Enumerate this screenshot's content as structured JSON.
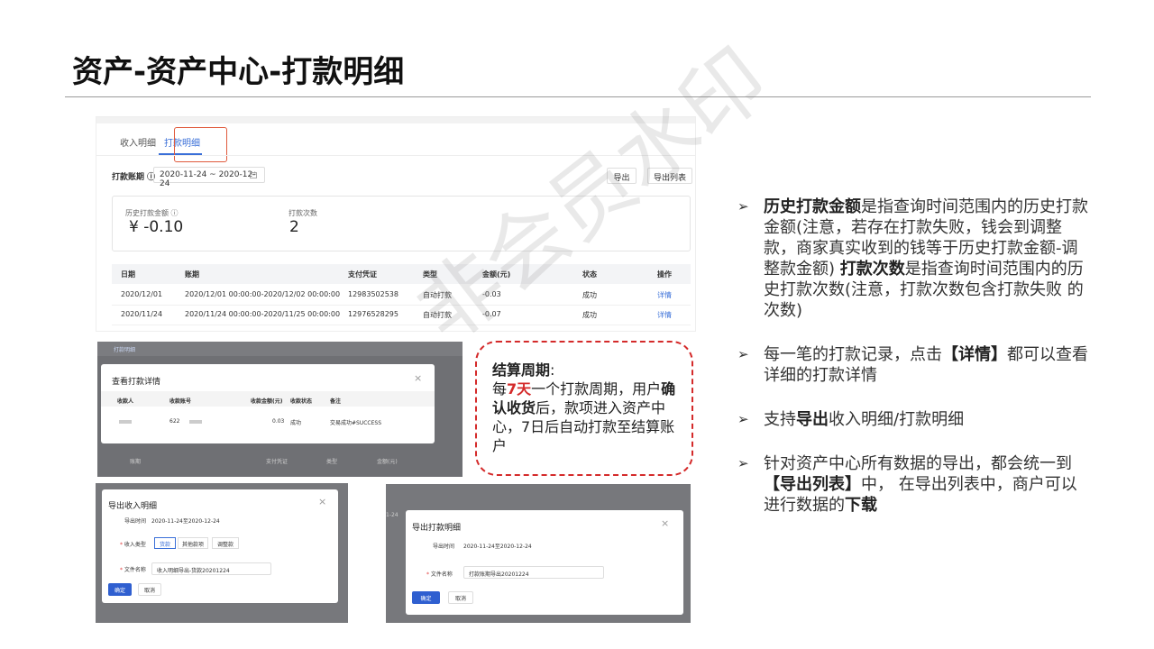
{
  "title": "资产-资产中心-打款明细",
  "watermark": "非会员水印",
  "screenshot_main": {
    "tabs": [
      {
        "label": "收入明细"
      },
      {
        "label": "打款明细"
      }
    ],
    "period_label": "打款账期 ⓘ",
    "period_value": "2020-11-24 ~ 2020-12-24",
    "calendar_icon": "calendar-icon",
    "export_label": "导出",
    "export_list_label": "导出列表",
    "stats": {
      "history_amount_label": "历史打款金额 ⓘ",
      "history_amount_value": "¥ -0.10",
      "count_label": "打款次数",
      "count_value": "2"
    },
    "table": {
      "headers": [
        "日期",
        "账期",
        "支付凭证",
        "类型",
        "金额(元)",
        "状态",
        "操作"
      ],
      "rows": [
        [
          "2020/12/01",
          "2020/12/01 00:00:00-2020/12/02 00:00:00",
          "12983502538",
          "自动打款",
          "-0.03",
          "成功",
          "详情"
        ],
        [
          "2020/11/24",
          "2020/11/24 00:00:00-2020/11/25 00:00:00",
          "12976528295",
          "自动打款",
          "-0.07",
          "成功",
          "详情"
        ]
      ]
    }
  },
  "detail_modal": {
    "tab_label": "打款明细",
    "title": "查看打款详情",
    "close": "×",
    "headers": [
      "收款人",
      "收款账号",
      "收款金额(元)",
      "收款状态",
      "备注"
    ],
    "row": [
      "",
      "622",
      "0.03",
      "成功",
      "交易成功#SUCCESS"
    ],
    "bg_headers": [
      "账期",
      "支付凭证",
      "类型",
      "金额(元)"
    ]
  },
  "callout": {
    "label": "结算周期",
    "colon": ":",
    "t1": "每",
    "highlight": "7天",
    "t2": "一个打款周期，用户",
    "bold2": "确认收货",
    "t3": "后，款项进入资产中心，7日后自动打款至结算账户"
  },
  "export_income_modal": {
    "title": "导出收入明细",
    "close": "×",
    "time_label": "导出时间",
    "time_value": "2020-11-24至2020-12-24",
    "type_label": "收入类型",
    "type_options": [
      "货款",
      "其他款项",
      "调整款"
    ],
    "filename_label": "文件名称",
    "filename_value": "收入明细导出-货款20201224",
    "confirm": "确定",
    "cancel": "取消"
  },
  "export_payout_modal": {
    "bg_text": "1-24",
    "title": "导出打款明细",
    "close": "×",
    "time_label": "导出时间",
    "time_value": "2020-11-24至2020-12-24",
    "filename_label": "文件名称",
    "filename_value": "打款账期导出20201224",
    "confirm": "确定",
    "cancel": "取消"
  },
  "bullets": {
    "arrow": "➢",
    "b1_bold1": "历史打款金额",
    "b1_t1": "是指查询时间范围内的历史打款金额(注意，若存在打款失败，钱会到调整款，商家真实收到的钱等于历史打款金额-调整款金额) ",
    "b1_bold2": "打款次数",
    "b1_t2": "是指查询时间范围内的历史打款次数(注意，打款次数包含打款失败 的次数)",
    "b2_t1": "每一笔的打款记录，点击",
    "b2_bold": "【详情】",
    "b2_t2": "都可以查看详细的打款详情",
    "b3_t1": "支持",
    "b3_bold": "导出",
    "b3_t2": "收入明细/打款明细",
    "b4_t1": "针对资产中心所有数据的导出，都会统一到",
    "b4_bold1": "【导出列表】",
    "b4_t2": "中， 在导出列表中，商户可以进行数据的",
    "b4_bold2": "下载"
  }
}
